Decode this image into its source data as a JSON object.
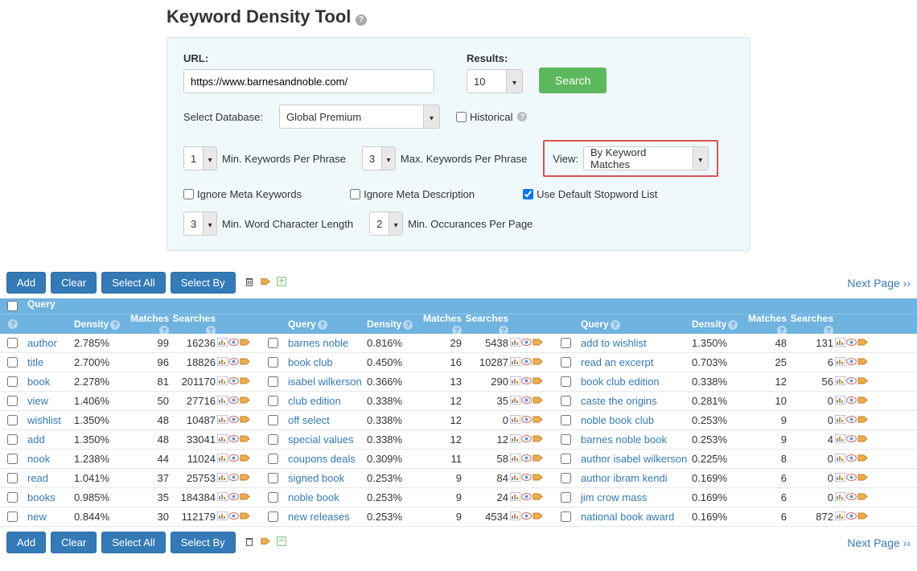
{
  "page_title": "Keyword Density Tool",
  "form": {
    "url_label": "URL:",
    "url_value": "https://www.barnesandnoble.com/",
    "results_label": "Results:",
    "results_value": "10",
    "search_btn": "Search",
    "select_db_label": "Select Database:",
    "select_db_value": "Global Premium",
    "historical_label": "Historical",
    "min_kw_value": "1",
    "min_kw_label": "Min. Keywords Per Phrase",
    "max_kw_value": "3",
    "max_kw_label": "Max. Keywords Per Phrase",
    "view_label": "View:",
    "view_value": "By Keyword Matches",
    "ignore_meta_kw": "Ignore Meta Keywords",
    "ignore_meta_desc": "Ignore Meta Description",
    "use_stopword": "Use Default Stopword List",
    "min_char_value": "3",
    "min_char_label": "Min. Word Character Length",
    "min_occ_value": "2",
    "min_occ_label": "Min. Occurances Per Page"
  },
  "toolbar": {
    "add": "Add",
    "clear": "Clear",
    "select_all": "Select All",
    "select_by": "Select By",
    "next_page": "Next Page ››"
  },
  "headers": {
    "query": "Query",
    "density": "Density",
    "matches": "Matches",
    "searches": "Searches"
  },
  "cols": [
    [
      {
        "q": "author",
        "d": "2.785%",
        "m": "99",
        "s": "16236"
      },
      {
        "q": "title",
        "d": "2.700%",
        "m": "96",
        "s": "18826"
      },
      {
        "q": "book",
        "d": "2.278%",
        "m": "81",
        "s": "201170"
      },
      {
        "q": "view",
        "d": "1.406%",
        "m": "50",
        "s": "27716"
      },
      {
        "q": "wishlist",
        "d": "1.350%",
        "m": "48",
        "s": "10487"
      },
      {
        "q": "add",
        "d": "1.350%",
        "m": "48",
        "s": "33041"
      },
      {
        "q": "nook",
        "d": "1.238%",
        "m": "44",
        "s": "11024"
      },
      {
        "q": "read",
        "d": "1.041%",
        "m": "37",
        "s": "25753"
      },
      {
        "q": "books",
        "d": "0.985%",
        "m": "35",
        "s": "184384"
      },
      {
        "q": "new",
        "d": "0.844%",
        "m": "30",
        "s": "112179"
      }
    ],
    [
      {
        "q": "barnes noble",
        "d": "0.816%",
        "m": "29",
        "s": "5438"
      },
      {
        "q": "book club",
        "d": "0.450%",
        "m": "16",
        "s": "10287"
      },
      {
        "q": "isabel wilkerson",
        "d": "0.366%",
        "m": "13",
        "s": "290"
      },
      {
        "q": "club edition",
        "d": "0.338%",
        "m": "12",
        "s": "35"
      },
      {
        "q": "off select",
        "d": "0.338%",
        "m": "12",
        "s": "0"
      },
      {
        "q": "special values",
        "d": "0.338%",
        "m": "12",
        "s": "12"
      },
      {
        "q": "coupons deals",
        "d": "0.309%",
        "m": "11",
        "s": "58"
      },
      {
        "q": "signed book",
        "d": "0.253%",
        "m": "9",
        "s": "84"
      },
      {
        "q": "noble book",
        "d": "0.253%",
        "m": "9",
        "s": "24"
      },
      {
        "q": "new releases",
        "d": "0.253%",
        "m": "9",
        "s": "4534"
      }
    ],
    [
      {
        "q": "add to wishlist",
        "d": "1.350%",
        "m": "48",
        "s": "131"
      },
      {
        "q": "read an excerpt",
        "d": "0.703%",
        "m": "25",
        "s": "6"
      },
      {
        "q": "book club edition",
        "d": "0.338%",
        "m": "12",
        "s": "56"
      },
      {
        "q": "caste the origins",
        "d": "0.281%",
        "m": "10",
        "s": "0"
      },
      {
        "q": "noble book club",
        "d": "0.253%",
        "m": "9",
        "s": "0"
      },
      {
        "q": "barnes noble book",
        "d": "0.253%",
        "m": "9",
        "s": "4"
      },
      {
        "q": "author isabel wilkerson",
        "d": "0.225%",
        "m": "8",
        "s": "0"
      },
      {
        "q": "author ibram kendi",
        "d": "0.169%",
        "m": "6",
        "s": "0"
      },
      {
        "q": "jim crow mass",
        "d": "0.169%",
        "m": "6",
        "s": "0"
      },
      {
        "q": "national book award",
        "d": "0.169%",
        "m": "6",
        "s": "872"
      }
    ]
  ]
}
